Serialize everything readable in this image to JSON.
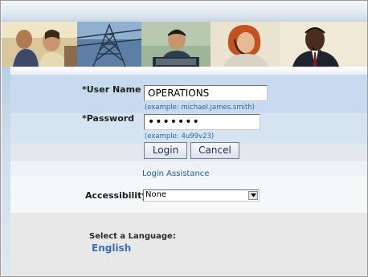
{
  "form": {
    "username_label": "*User Name",
    "username_value": "OPERATIONS",
    "username_hint": "(example: michael.james.smith)",
    "password_label": "*Password",
    "password_value": "•••••••",
    "password_hint": "(example: 4u99v23)",
    "login_button": "Login",
    "cancel_button": "Cancel",
    "assistance_link": "Login Assistance",
    "accessibility_label": "Accessibility",
    "accessibility_value": "None"
  },
  "language": {
    "title": "Select a Language:",
    "selected": "English"
  },
  "banner": {
    "photos": [
      "people-photo-1",
      "tower-photo",
      "man-at-laptop-photo",
      "woman-headset-photo",
      "man-headset-photo"
    ]
  }
}
